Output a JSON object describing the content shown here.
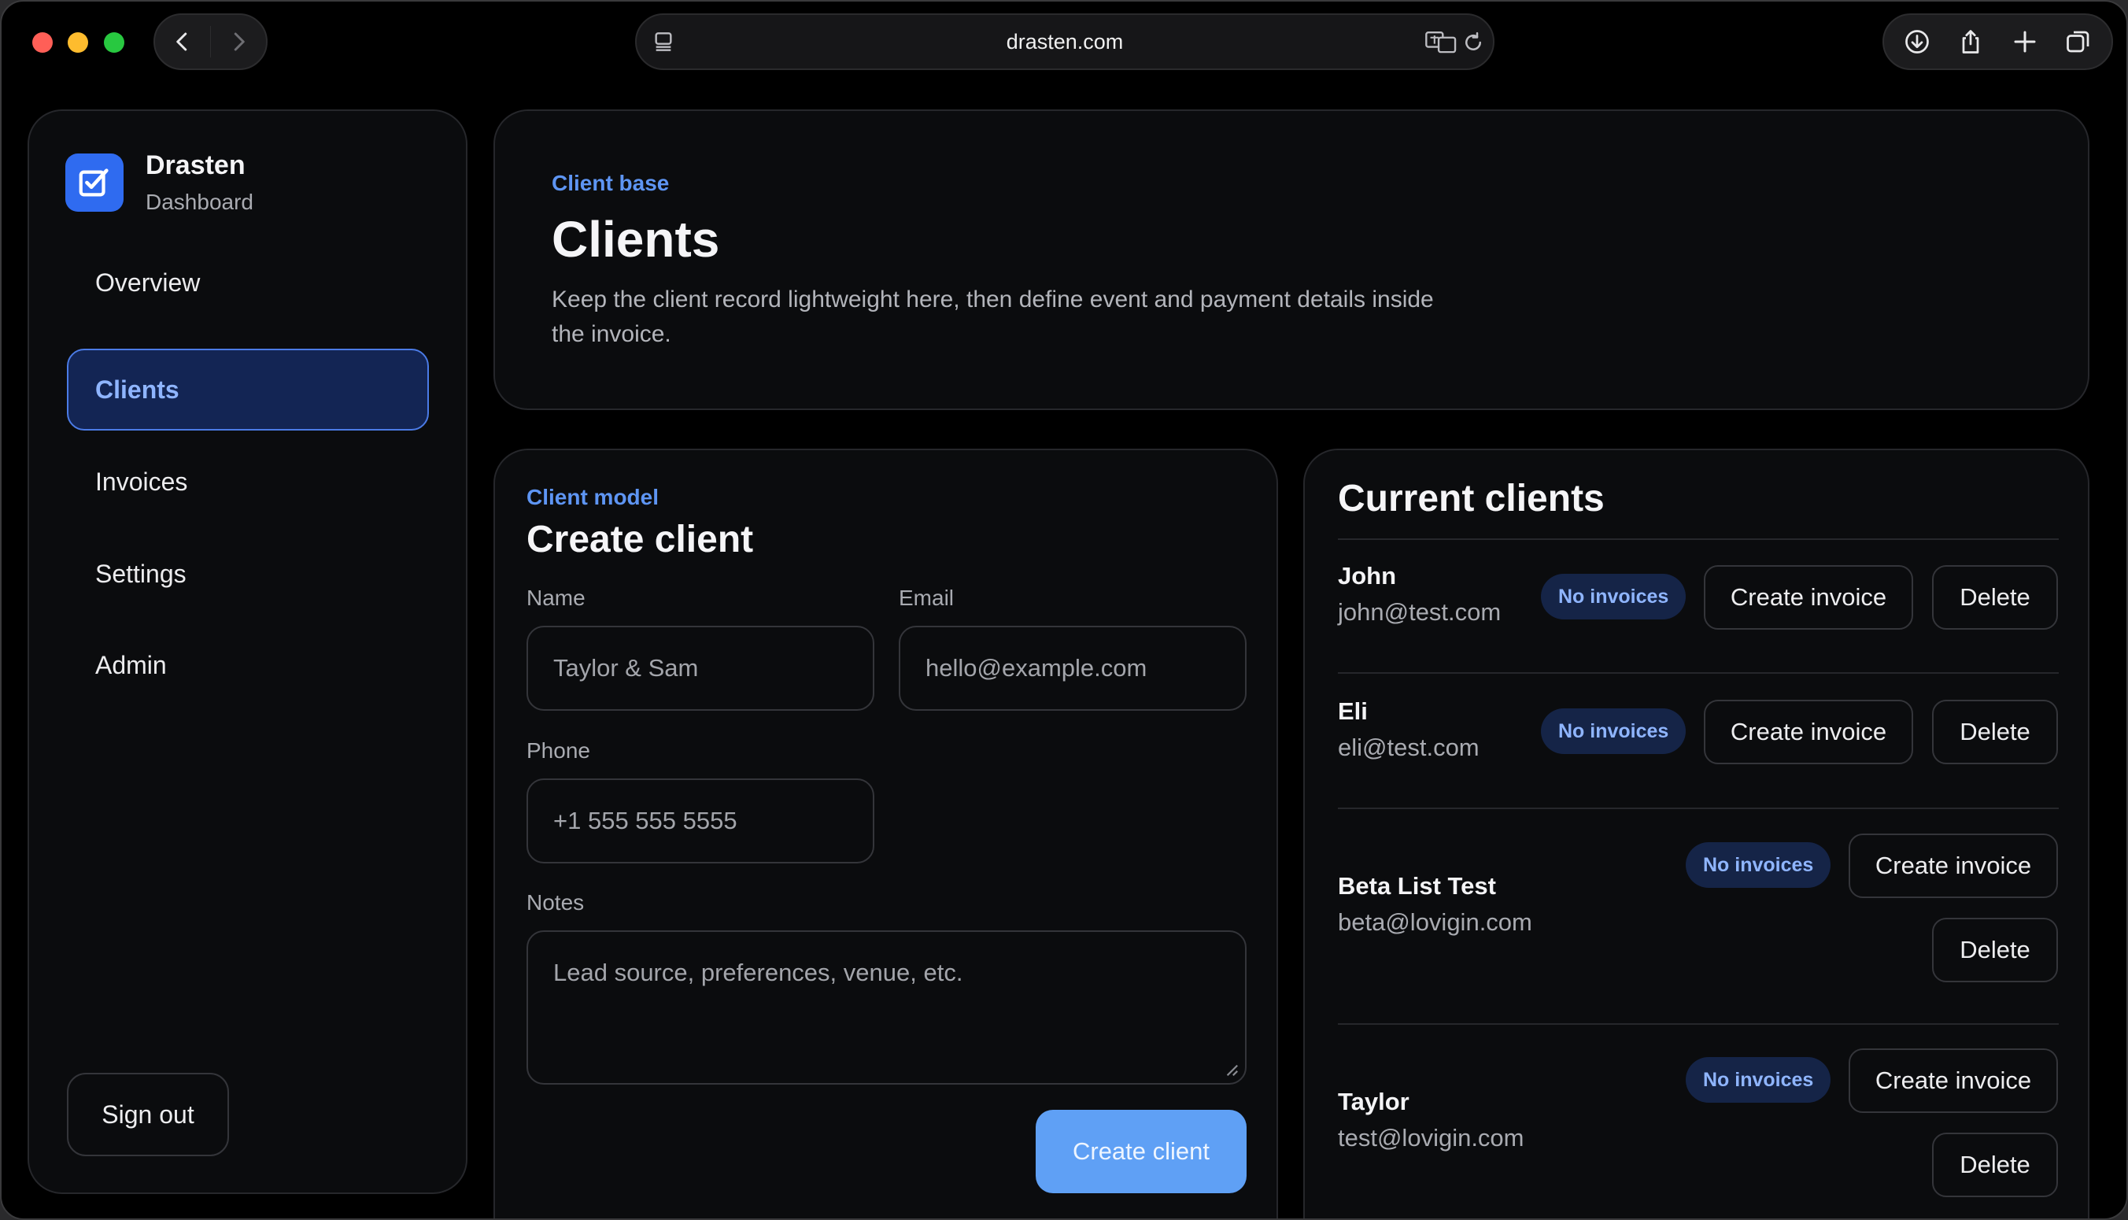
{
  "browser": {
    "url": "drasten.com"
  },
  "brand": {
    "name": "Drasten",
    "subtitle": "Dashboard",
    "accent": "#2f6bf0"
  },
  "sidebar": {
    "items": [
      {
        "label": "Overview",
        "active": false
      },
      {
        "label": "Clients",
        "active": true
      },
      {
        "label": "Invoices",
        "active": false
      },
      {
        "label": "Settings",
        "active": false
      },
      {
        "label": "Admin",
        "active": false
      }
    ],
    "signout_label": "Sign out"
  },
  "header": {
    "eyebrow": "Client base",
    "title": "Clients",
    "description": "Keep the client record lightweight here, then define event and payment details inside the invoice."
  },
  "form": {
    "eyebrow": "Client model",
    "title": "Create client",
    "name_label": "Name",
    "name_placeholder": "Taylor & Sam",
    "email_label": "Email",
    "email_placeholder": "hello@example.com",
    "phone_label": "Phone",
    "phone_placeholder": "+1 555 555 5555",
    "notes_label": "Notes",
    "notes_placeholder": "Lead source, preferences, venue, etc.",
    "submit_label": "Create client",
    "submit_color": "#5fa0f5"
  },
  "clients": {
    "title": "Current clients",
    "badge_label": "No invoices",
    "create_invoice_label": "Create invoice",
    "delete_label": "Delete",
    "list": [
      {
        "name": "John",
        "email": "john@test.com"
      },
      {
        "name": "Eli",
        "email": "eli@test.com"
      },
      {
        "name": "Beta List Test",
        "email": "beta@lovigin.com"
      },
      {
        "name": "Taylor",
        "email": "test@lovigin.com"
      }
    ]
  }
}
